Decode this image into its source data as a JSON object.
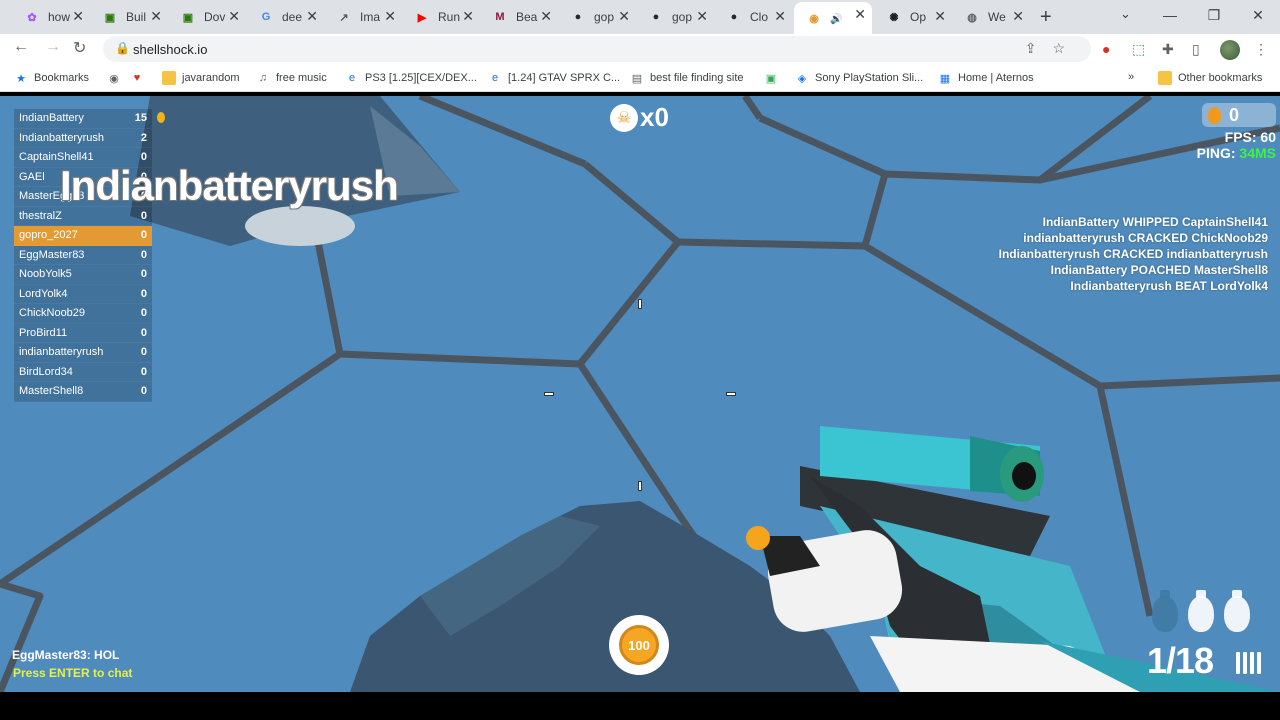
{
  "browser": {
    "tabs": [
      {
        "label": "how",
        "icon": "figma-icon",
        "color": "#a259ff"
      },
      {
        "label": "Buil",
        "icon": "mod-icon",
        "color": "#2b7a0b"
      },
      {
        "label": "Dov",
        "icon": "mod-icon",
        "color": "#2b7a0b"
      },
      {
        "label": "dee",
        "icon": "google-icon",
        "color": "#4285f4"
      },
      {
        "label": "Ima",
        "icon": "chart-icon",
        "color": "#555555"
      },
      {
        "label": "Run",
        "icon": "youtube-icon",
        "color": "#ff0000"
      },
      {
        "label": "Bea",
        "icon": "m-icon",
        "color": "#8b1a3b"
      },
      {
        "label": "gop",
        "icon": "github-icon",
        "color": "#24292e"
      },
      {
        "label": "gop",
        "icon": "github-icon",
        "color": "#24292e"
      },
      {
        "label": "Clo",
        "icon": "github-icon",
        "color": "#24292e"
      },
      {
        "label": "",
        "icon": "shellshock-icon",
        "color": "#e39a32",
        "active": true
      },
      {
        "label": "Op",
        "icon": "openai-icon",
        "color": "#202124"
      },
      {
        "label": "We",
        "icon": "globe-icon",
        "color": "#5f6368"
      }
    ],
    "url": "shellshock.io",
    "profile_badge": "23",
    "bookmarks": [
      {
        "label": "Bookmarks",
        "icon": "star-icon"
      },
      {
        "label": "",
        "icon": "chrome-icon"
      },
      {
        "label": "",
        "icon": "heart-icon"
      },
      {
        "label": "javarandom",
        "icon": "folder-icon"
      },
      {
        "label": "free music",
        "icon": "music-icon"
      },
      {
        "label": "PS3 [1.25][CEX/DEX...",
        "icon": "e-icon"
      },
      {
        "label": "[1.24] GTAV SPRX C...",
        "icon": "e-icon"
      },
      {
        "label": "best file finding site",
        "icon": "file-icon"
      },
      {
        "label": "",
        "icon": "game-icon"
      },
      {
        "label": "Sony PlayStation Sli...",
        "icon": "ps-icon"
      },
      {
        "label": "Home | Aternos",
        "icon": "aternos-icon"
      }
    ],
    "other_bookmarks": "Other bookmarks"
  },
  "game": {
    "scoreboard": [
      {
        "name": "IndianBattery",
        "score": "15"
      },
      {
        "name": "Indianbatteryrush",
        "score": "2"
      },
      {
        "name": "CaptainShell41",
        "score": "0"
      },
      {
        "name": "GAEl",
        "score": "0"
      },
      {
        "name": "MasterEgg83",
        "score": "0"
      },
      {
        "name": "thestralZ",
        "score": "0"
      },
      {
        "name": "gopro_2027",
        "score": "0",
        "me": true
      },
      {
        "name": "EggMaster83",
        "score": "0"
      },
      {
        "name": "NoobYolk5",
        "score": "0"
      },
      {
        "name": "LordYolk4",
        "score": "0"
      },
      {
        "name": "ChickNoob29",
        "score": "0"
      },
      {
        "name": "ProBird11",
        "score": "0"
      },
      {
        "name": "indianbatteryrush",
        "score": "0"
      },
      {
        "name": "BirdLord34",
        "score": "0"
      },
      {
        "name": "MasterShell8",
        "score": "0"
      }
    ],
    "spectating_name": "Indianbatteryrush",
    "killstreak": "x0",
    "eggs": "0",
    "fps_label": "FPS: 60",
    "ping_label": "PING:",
    "ping_value": "34MS",
    "killfeed": [
      "IndianBattery WHIPPED CaptainShell41",
      "indianbatteryrush CRACKED ChickNoob29",
      "Indianbatteryrush CRACKED indianbatteryrush",
      "IndianBattery POACHED MasterShell8",
      "Indianbatteryrush BEAT LordYolk4"
    ],
    "health": "100",
    "chat_line": "EggMaster83: HOL",
    "chat_prompt": "Press ENTER to chat",
    "ammo": "1/18",
    "colors": {
      "sky": "#4f8bbd",
      "me_row": "#e39a32",
      "ping_ok": "#3cf24b",
      "hex_line": "#4b5560"
    }
  }
}
